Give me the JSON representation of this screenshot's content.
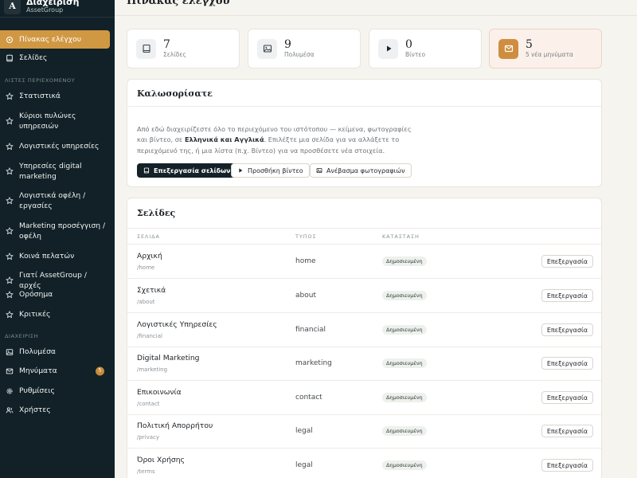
{
  "brand": {
    "logo_letter": "A",
    "title": "Διαχείριση",
    "subtitle": "AssetGroup"
  },
  "sidebar": {
    "main_items": [
      {
        "label": "Πίνακας ελέγχου",
        "icon": "dashboard-icon",
        "active": true
      },
      {
        "label": "Σελίδες",
        "icon": "book-icon"
      }
    ],
    "content_section": "ΛΙΣΤΕΣ ΠΕΡΙΕΧΟΜΕΝΟΥ",
    "content_items": [
      {
        "label": "Στατιστικά",
        "icon": "star-icon"
      },
      {
        "label": "Κύριοι πυλώνες υπηρεσιών",
        "icon": "star-icon"
      },
      {
        "label": "Λογιστικές υπηρεσίες",
        "icon": "star-icon"
      },
      {
        "label": "Υπηρεσίες digital marketing",
        "icon": "star-icon"
      },
      {
        "label": "Λογιστικά οφέλη / εργασίες",
        "icon": "star-icon"
      },
      {
        "label": "Marketing προσέγγιση / οφέλη",
        "icon": "star-icon"
      },
      {
        "label": "Κοινά πελατών",
        "icon": "star-icon"
      },
      {
        "label": "Γιατί AssetGroup / αρχές",
        "icon": "star-icon"
      },
      {
        "label": "Ορόσημα",
        "icon": "star-icon"
      },
      {
        "label": "Κριτικές",
        "icon": "star-icon"
      }
    ],
    "admin_section": "ΔΙΑΧΕΙΡΙΣΗ",
    "admin_items": [
      {
        "label": "Πολυμέσα",
        "icon": "image-icon"
      },
      {
        "label": "Μηνύματα",
        "icon": "mail-icon",
        "badge": "5"
      },
      {
        "label": "Ρυθμίσεις",
        "icon": "gear-icon"
      },
      {
        "label": "Χρήστες",
        "icon": "users-icon"
      }
    ]
  },
  "header": {
    "title": "Πίνακας ελέγχου"
  },
  "stats": [
    {
      "value": "7",
      "label": "Σελίδες",
      "icon": "book-icon"
    },
    {
      "value": "9",
      "label": "Πολυμέσα",
      "icon": "image-icon"
    },
    {
      "value": "0",
      "label": "Βίντεο",
      "icon": "play-icon"
    },
    {
      "value": "5",
      "label": "5 νέα μηνύματα",
      "icon": "mail-icon"
    }
  ],
  "welcome": {
    "title": "Καλωσορίσατε",
    "text_before": "Από εδώ διαχειρίζεστε όλο το περιεχόμενο του ιστότοπου — κείμενα, φωτογραφίες και βίντεο, σε ",
    "text_bold": "Ελληνικά και Αγγλικά",
    "text_after": ". Επιλέξτε μια σελίδα για να αλλάξετε το περιεχόμενό της, ή μια λίστα (π.χ. Βίντεο) για να προσθέσετε νέα στοιχεία.",
    "buttons": {
      "edit_pages": "Επεξεργασία σελίδων",
      "add_video": "Προσθήκη βίντεο",
      "upload_photos": "Ανέβασμα φωτογραφιών"
    }
  },
  "pages_table": {
    "title": "Σελίδες",
    "columns": [
      "ΣΕΛΙΔΑ",
      "ΤΥΠΟΣ",
      "ΚΑΤΑΣΤΑΣΗ"
    ],
    "edit_label": "Επεξεργασία",
    "rows": [
      {
        "name": "Αρχική",
        "slug": "/home",
        "type": "home",
        "status": "Δημοσιευμένη"
      },
      {
        "name": "Σχετικά",
        "slug": "/about",
        "type": "about",
        "status": "Δημοσιευμένη"
      },
      {
        "name": "Λογιστικές Υπηρεσίες",
        "slug": "/financial",
        "type": "financial",
        "status": "Δημοσιευμένη"
      },
      {
        "name": "Digital Marketing",
        "slug": "/marketing",
        "type": "marketing",
        "status": "Δημοσιευμένη"
      },
      {
        "name": "Επικοινωνία",
        "slug": "/contact",
        "type": "contact",
        "status": "Δημοσιευμένη"
      },
      {
        "name": "Πολιτική Απορρήτου",
        "slug": "/privacy",
        "type": "legal",
        "status": "Δημοσιευμένη"
      },
      {
        "name": "Όροι Χρήσης",
        "slug": "/terms",
        "type": "legal",
        "status": "Δημοσιευμένη"
      }
    ]
  },
  "colors": {
    "sidebar_bg": "#112127",
    "accent": "#d19843",
    "primary_button": "#142228"
  }
}
